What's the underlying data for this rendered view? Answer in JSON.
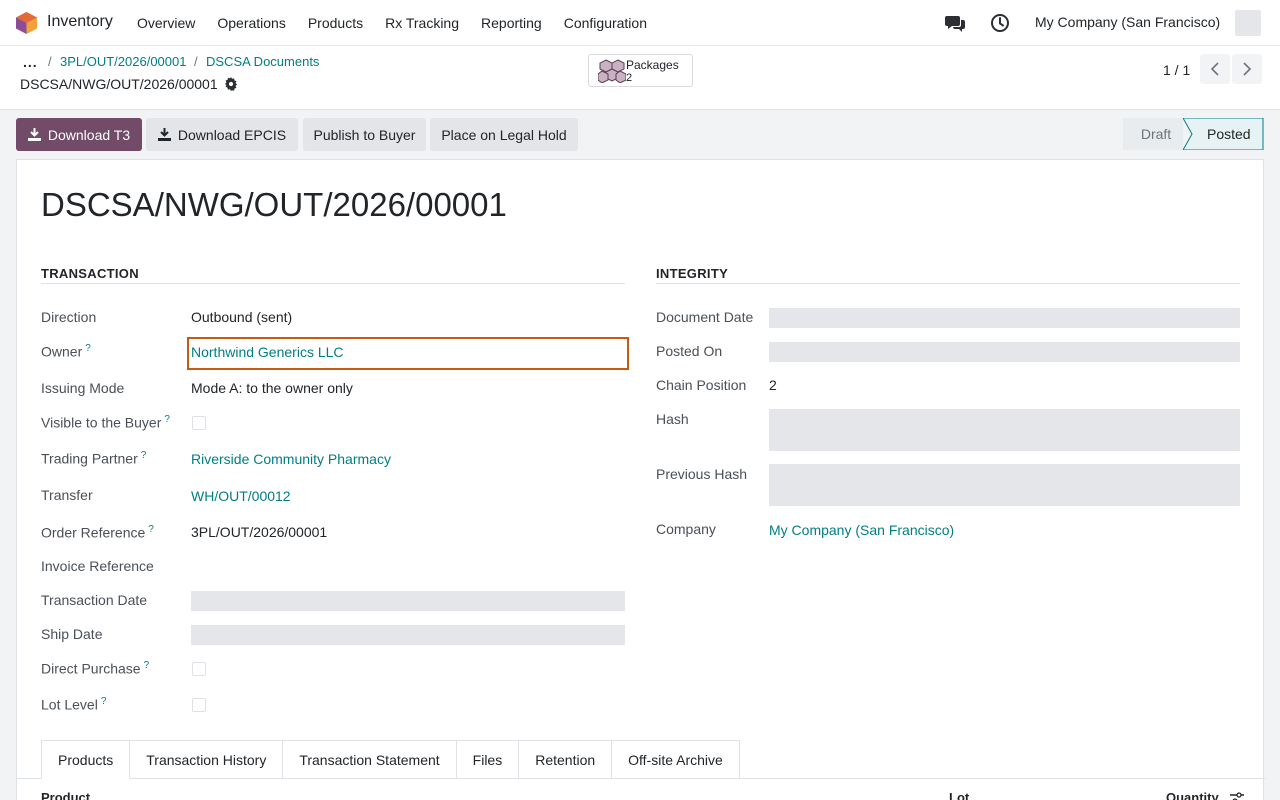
{
  "navbar": {
    "app_name": "Inventory",
    "menu": [
      "Overview",
      "Operations",
      "Products",
      "Rx Tracking",
      "Reporting",
      "Configuration"
    ],
    "company": "My Company (San Francisco)"
  },
  "breadcrumb": {
    "dots": "...",
    "items": [
      "3PL/OUT/2026/00001",
      "DSCSA Documents"
    ],
    "current": "DSCSA/NWG/OUT/2026/00001"
  },
  "smart_button": {
    "label": "Packages",
    "count": "2"
  },
  "pager": {
    "text": "1 / 1"
  },
  "actions": {
    "download_t3": "Download T3",
    "download_epcis": "Download EPCIS",
    "publish": "Publish to Buyer",
    "legal_hold": "Place on Legal Hold"
  },
  "status": {
    "draft": "Draft",
    "posted": "Posted",
    "current": "Posted"
  },
  "record": {
    "title": "DSCSA/NWG/OUT/2026/00001",
    "transaction": {
      "heading": "TRANSACTION",
      "direction_label": "Direction",
      "direction": "Outbound (sent)",
      "owner_label": "Owner",
      "owner": "Northwind Generics LLC",
      "issuing_mode_label": "Issuing Mode",
      "issuing_mode": "Mode A: to the owner only",
      "visible_label": "Visible to the Buyer",
      "trading_partner_label": "Trading Partner",
      "trading_partner": "Riverside Community Pharmacy",
      "transfer_label": "Transfer",
      "transfer": "WH/OUT/00012",
      "order_ref_label": "Order Reference",
      "order_ref": "3PL/OUT/2026/00001",
      "invoice_ref_label": "Invoice Reference",
      "transaction_date_label": "Transaction Date",
      "ship_date_label": "Ship Date",
      "direct_purchase_label": "Direct Purchase",
      "lot_level_label": "Lot Level"
    },
    "integrity": {
      "heading": "INTEGRITY",
      "document_date_label": "Document Date",
      "posted_on_label": "Posted On",
      "chain_position_label": "Chain Position",
      "chain_position": "2",
      "hash_label": "Hash",
      "previous_hash_label": "Previous Hash",
      "company_label": "Company",
      "company": "My Company (San Francisco)"
    }
  },
  "tabs": [
    "Products",
    "Transaction History",
    "Transaction Statement",
    "Files",
    "Retention",
    "Off-site Archive"
  ],
  "table": {
    "col_product": "Product",
    "col_lot": "Lot",
    "col_quantity": "Quantity"
  },
  "help_marker": "?",
  "colors": {
    "primary": "#714b67",
    "link": "#017e84",
    "focus": "#c65a11"
  }
}
